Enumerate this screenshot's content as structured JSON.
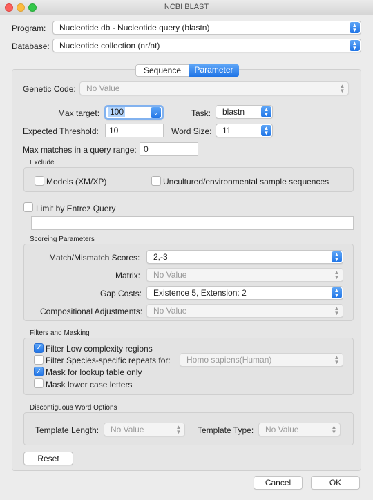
{
  "window": {
    "title": "NCBI BLAST"
  },
  "program": {
    "label": "Program:",
    "value": "Nucleotide db - Nucleotide query (blastn)"
  },
  "database": {
    "label": "Database:",
    "value": "Nucleotide collection (nr/nt)"
  },
  "tabs": [
    {
      "label": "Sequence",
      "selected": false
    },
    {
      "label": "Parameter",
      "selected": true
    }
  ],
  "genetic_code": {
    "label": "Genetic Code:",
    "placeholder": "No Value"
  },
  "max_target": {
    "label": "Max target:",
    "value": "100"
  },
  "task": {
    "label": "Task:",
    "value": "blastn"
  },
  "expected_threshold": {
    "label": "Expected Threshold:",
    "value": "10"
  },
  "word_size": {
    "label": "Word Size:",
    "value": "11"
  },
  "max_matches": {
    "label": "Max matches in a query range:",
    "value": "0"
  },
  "exclude": {
    "title": "Exclude",
    "models": {
      "label": "Models (XM/XP)",
      "checked": false
    },
    "uncultured": {
      "label": "Uncultured/environmental sample sequences",
      "checked": false
    }
  },
  "entrez": {
    "label": "Limit by Entrez Query",
    "checked": false,
    "value": ""
  },
  "scoring": {
    "title": "Scoreing Parameters",
    "match_mismatch": {
      "label": "Match/Mismatch Scores:",
      "value": "2,-3"
    },
    "matrix": {
      "label": "Matrix:",
      "placeholder": "No Value"
    },
    "gap_costs": {
      "label": "Gap Costs:",
      "value": "Existence 5, Extension: 2"
    },
    "compositional": {
      "label": "Compositional Adjustments:",
      "placeholder": "No Value"
    }
  },
  "filters": {
    "title": "Filters and Masking",
    "low_complexity": {
      "label": "Filter Low complexity regions",
      "checked": true
    },
    "species_repeats": {
      "label": "Filter Species-specific repeats for:",
      "checked": false,
      "value": "Homo sapiens(Human)"
    },
    "mask_lookup": {
      "label": "Mask for lookup table only",
      "checked": true
    },
    "mask_lower": {
      "label": "Mask lower case letters",
      "checked": false
    }
  },
  "discontiguous": {
    "title": "Discontiguous Word Options",
    "template_length": {
      "label": "Template Length:",
      "placeholder": "No Value"
    },
    "template_type": {
      "label": "Template Type:",
      "placeholder": "No Value"
    }
  },
  "buttons": {
    "reset": "Reset",
    "cancel": "Cancel",
    "ok": "OK"
  },
  "colors": {
    "accent": "#1f74e6",
    "panel": "#e3e3e3",
    "window": "#ececec"
  }
}
